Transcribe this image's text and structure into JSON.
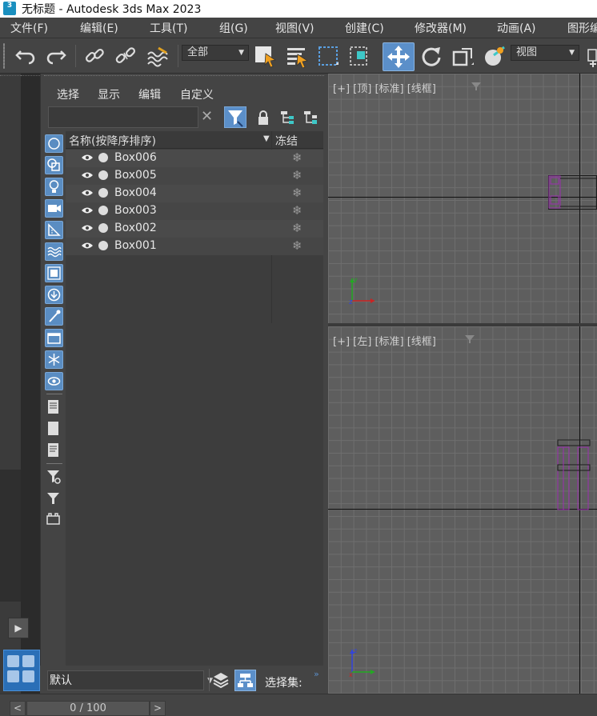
{
  "window": {
    "title": "无标题 - Autodesk 3ds Max 2023",
    "app_icon_text": "3"
  },
  "menu": [
    "文件(F)",
    "编辑(E)",
    "工具(T)",
    "组(G)",
    "视图(V)",
    "创建(C)",
    "修改器(M)",
    "动画(A)",
    "图形编"
  ],
  "toolbar": {
    "selection_filter": "全部",
    "reference_coord": "视图",
    "icons": [
      "undo-icon",
      "redo-icon",
      "link-icon",
      "unlink-icon",
      "bind-spacewarp-icon",
      "select-object-icon",
      "select-by-name-icon",
      "rect-selection-icon",
      "window-crossing-icon",
      "move-icon",
      "rotate-icon",
      "scale-icon",
      "pivot-icon"
    ]
  },
  "scene_explorer": {
    "tabs": [
      "选择",
      "显示",
      "编辑",
      "自定义"
    ],
    "search": {
      "value": "",
      "clear": "✕"
    },
    "columns": {
      "name": "名称(按降序排序)",
      "sort_indicator": "▼",
      "freeze": "冻结"
    },
    "objects": [
      "Box006",
      "Box005",
      "Box004",
      "Box003",
      "Box002",
      "Box001"
    ],
    "freeze_glyph": "❄",
    "layer": "默认",
    "selection_set_label": "选择集:"
  },
  "viewports": {
    "top": {
      "label": "[+] [顶] [标准] [线框]"
    },
    "left": {
      "label": "[+] [左] [标准] [线框]"
    }
  },
  "timeline": {
    "frame": "0 / 100",
    "prev": "<",
    "next": ">"
  },
  "colors": {
    "accent": "#5b8fc9",
    "object_wire": "#9c2fb0",
    "viewport_bg": "#5e5e5e"
  }
}
